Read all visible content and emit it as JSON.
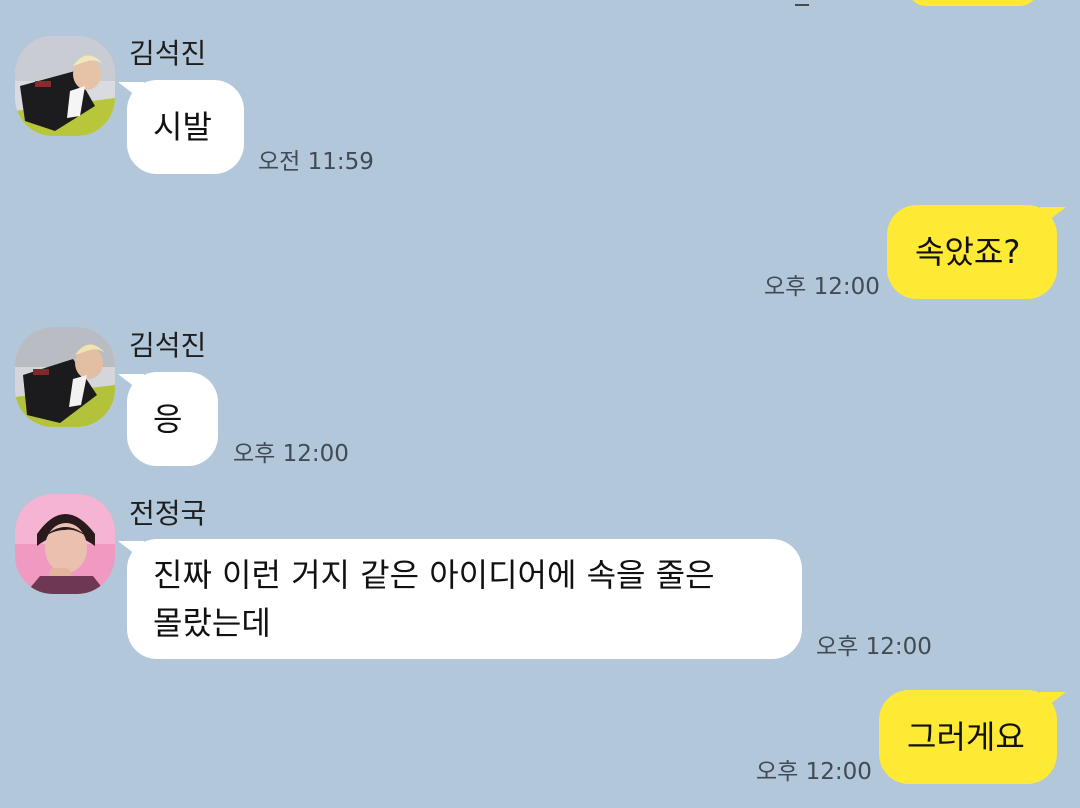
{
  "theme": {
    "background": "#b2c7da",
    "incoming_bubble": "#ffffff",
    "outgoing_bubble": "#fee934",
    "timestamp_color": "#424a54"
  },
  "messages": [
    {
      "direction": "incoming",
      "sender": "김석진",
      "avatar": "avatar-photo-kim-seokjin",
      "text": "시발",
      "time": "오전 11:59"
    },
    {
      "direction": "outgoing",
      "text": "속았죠?",
      "time": "오후 12:00"
    },
    {
      "direction": "incoming",
      "sender": "김석진",
      "avatar": "avatar-photo-kim-seokjin",
      "text": "응",
      "time": "오후 12:00"
    },
    {
      "direction": "incoming",
      "sender": "전정국",
      "avatar": "avatar-photo-jeon-jungkook",
      "text_lines": [
        "진짜 이런 거지 같은 아이디어에 속을 줄은",
        "몰랐는데"
      ],
      "time": "오후 12:00"
    },
    {
      "direction": "outgoing",
      "text": "그러게요",
      "time": "오후 12:00"
    }
  ]
}
